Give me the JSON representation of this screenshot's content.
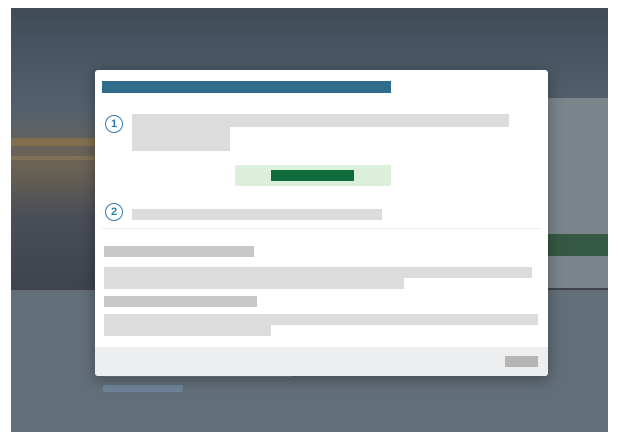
{
  "modal": {
    "title": "",
    "steps": [
      {
        "number": "1",
        "text": ""
      },
      {
        "number": "2",
        "text": ""
      }
    ],
    "primary_button_label": "",
    "footer_button_label": ""
  },
  "colors": {
    "title_bar": "#2f6c8b",
    "step_accent": "#2b7db3",
    "primary_button": "#0f6b3a",
    "primary_button_background": "#dcefda",
    "placeholder": "#dcdcdc",
    "footer": "#eceef0"
  }
}
